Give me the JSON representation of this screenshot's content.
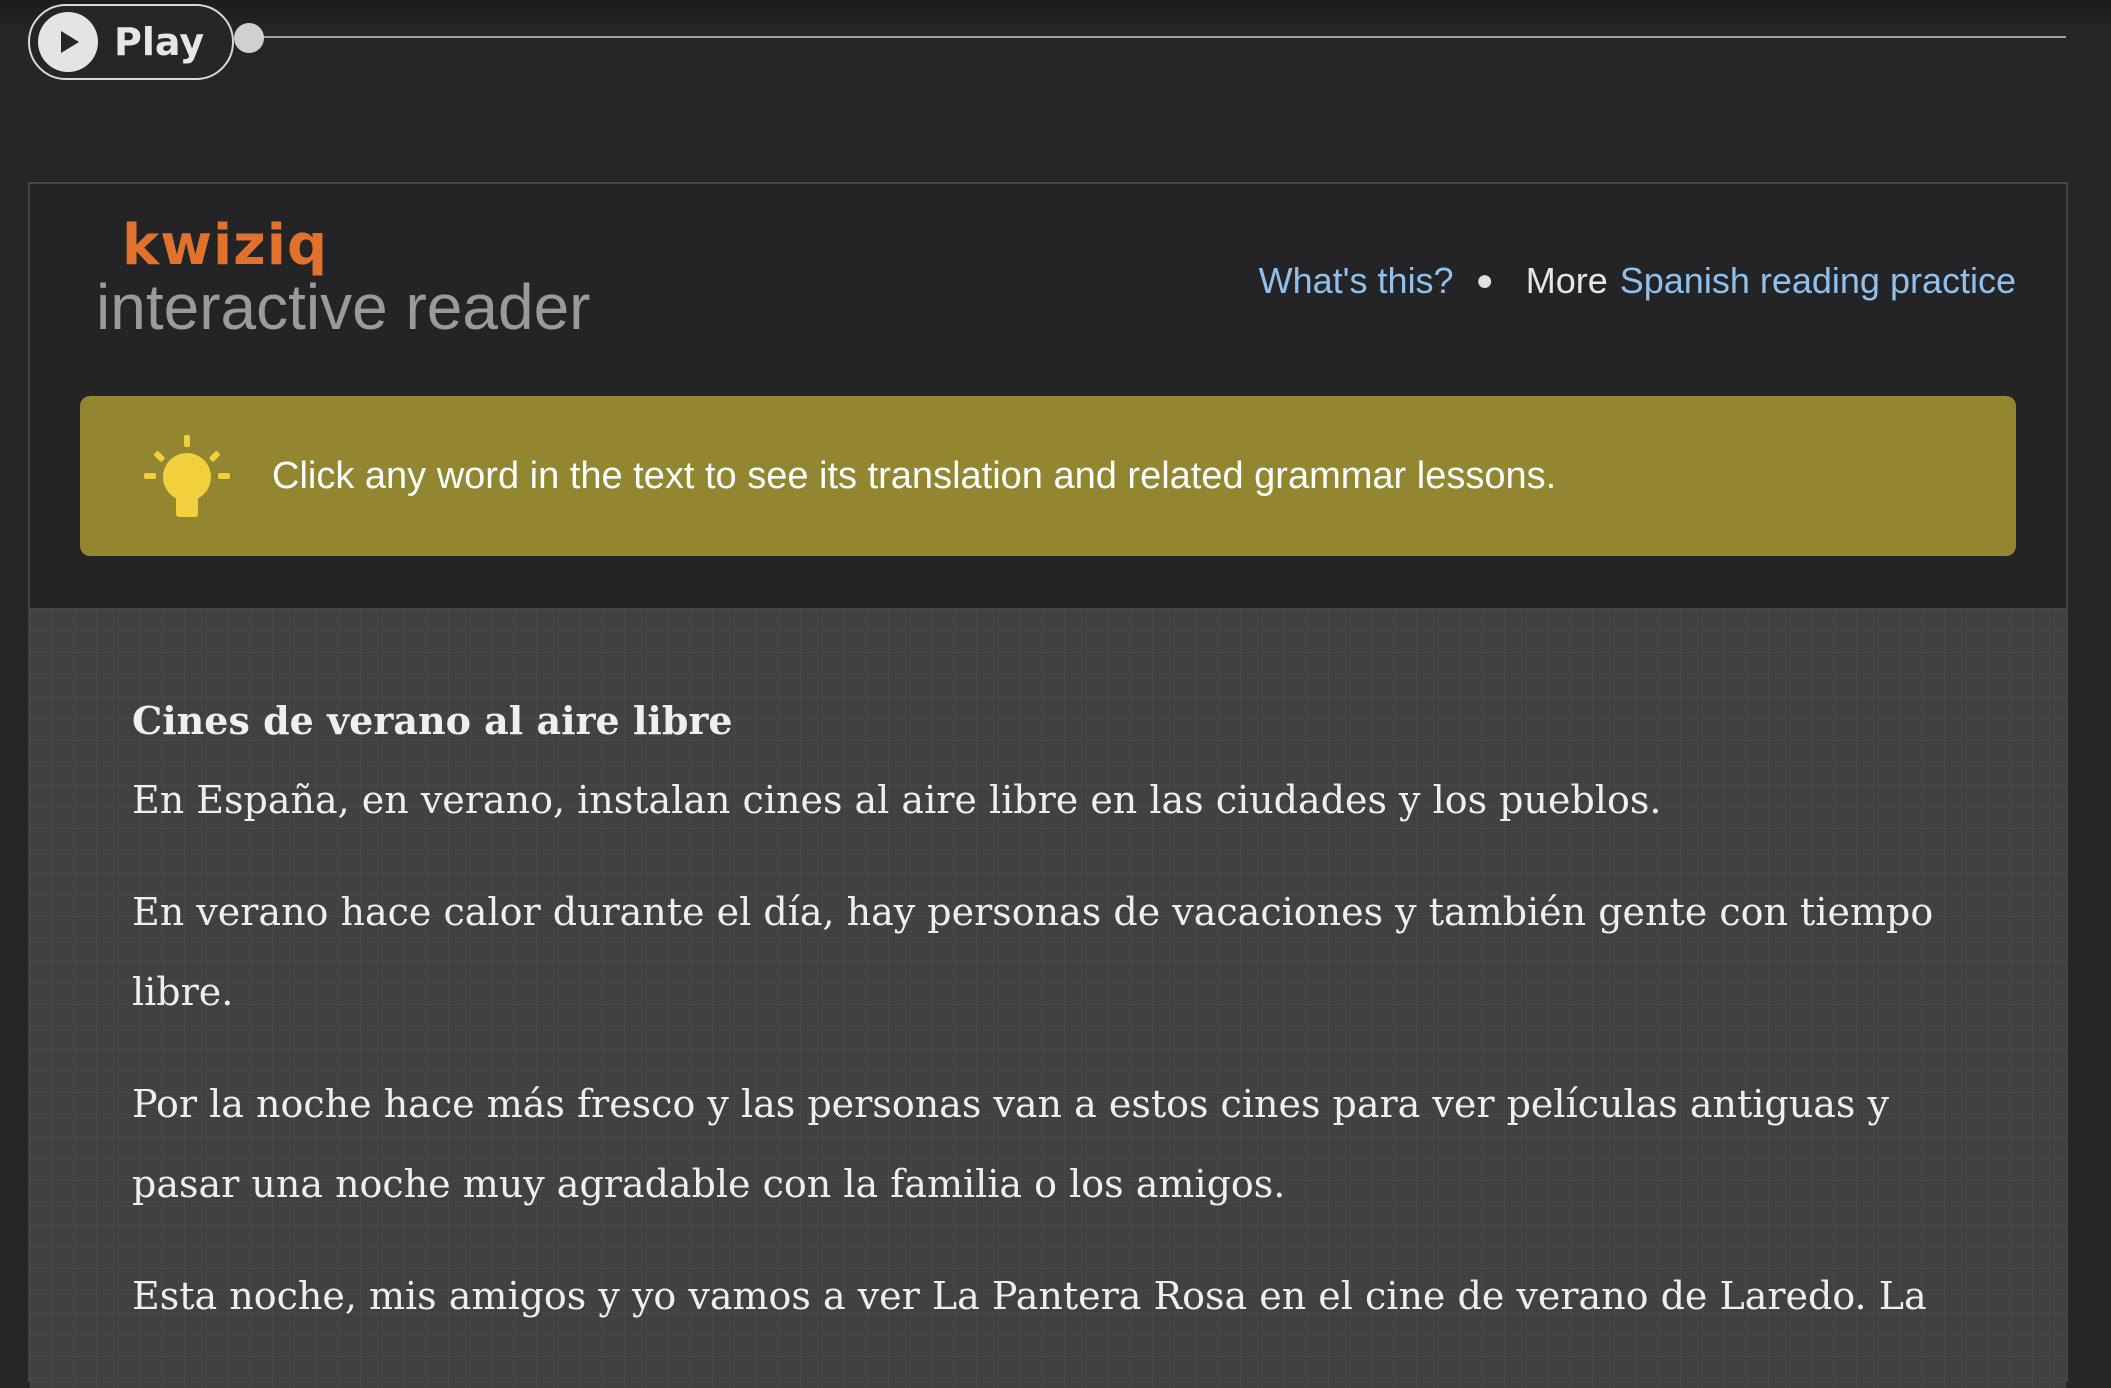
{
  "player": {
    "play_label": "Play",
    "progress": 0
  },
  "header": {
    "brand_logo": "kwiziq",
    "brand_subtitle": "interactive reader",
    "whats_this": "What's this?",
    "more_prefix": "More",
    "more_link": "Spanish reading practice"
  },
  "hint": {
    "icon": "lightbulb-icon",
    "text": "Click any word in the text to see its translation and related grammar lessons."
  },
  "story": {
    "title": "Cines de verano al aire libre",
    "paragraphs": [
      "En España, en verano,  instalan cines al aire libre  en las ciudades y los pueblos.",
      "En verano hace calor durante el día,  hay personas de vacaciones  y también gente con tiempo libre.",
      "Por la noche hace más fresco  y las personas van a estos cines  para ver películas antiguas  y pasar una noche muy agradable  con la familia o los amigos.",
      "Esta noche, mis amigos y yo  vamos a ver La Pantera Rosa  en el cine de verano de Laredo.  La"
    ]
  },
  "colors": {
    "brand_orange": "#e0722e",
    "link_blue": "#8fc1ec",
    "hint_bg": "#938630",
    "bulb_yellow": "#f2cf3c"
  }
}
